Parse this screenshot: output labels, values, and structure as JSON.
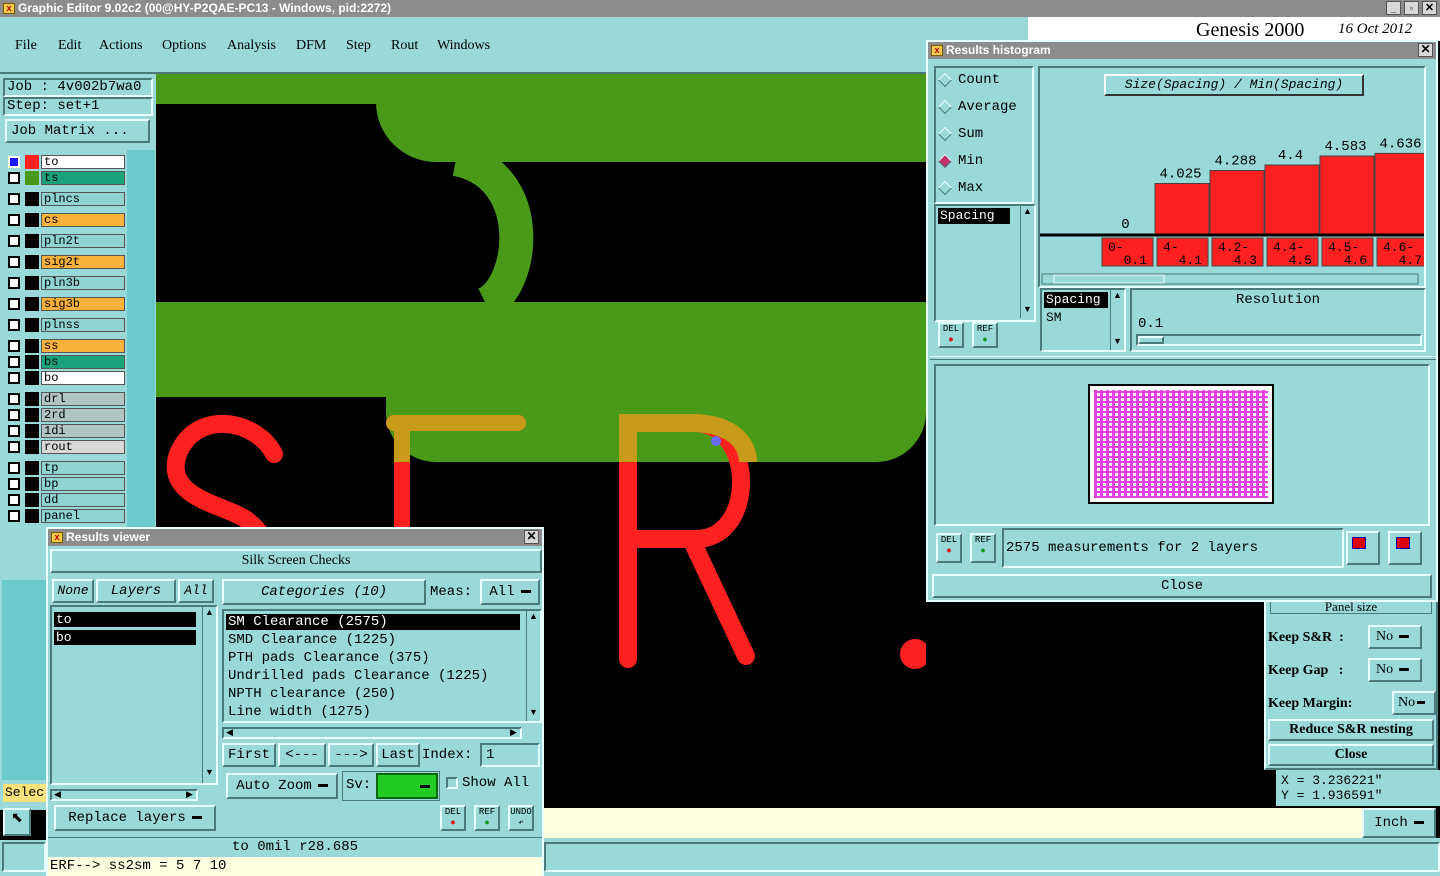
{
  "window": {
    "title": "Graphic Editor 9.02c2 (00@HY-P2QAE-PC13 - Windows, pid:2272)"
  },
  "menu": [
    "File",
    "Edit",
    "Actions",
    "Options",
    "Analysis",
    "DFM",
    "Step",
    "Rout",
    "Windows"
  ],
  "brand": {
    "text": "Genesis 2000",
    "date": "16 Oct 2012"
  },
  "job": {
    "job_label": "Job : 4v002b7wa0",
    "step_label": "Step: set+1",
    "matrix_button": "Job Matrix ..."
  },
  "layers": [
    {
      "name": "to",
      "color": "#ffffff",
      "swatch": "#ff2020"
    },
    {
      "name": "ts",
      "color": "#1aa37a",
      "swatch": "#4a9a1a"
    },
    {
      "name": "plncs",
      "color": "#8fd3d3",
      "swatch": "#000000"
    },
    {
      "name": "cs",
      "color": "#f8b23c",
      "swatch": "#000000"
    },
    {
      "name": "pln2t",
      "color": "#8fd3d3",
      "swatch": "#000000"
    },
    {
      "name": "sig2t",
      "color": "#f8b23c",
      "swatch": "#000000"
    },
    {
      "name": "pln3b",
      "color": "#8fd3d3",
      "swatch": "#000000"
    },
    {
      "name": "sig3b",
      "color": "#f8b23c",
      "swatch": "#000000"
    },
    {
      "name": "plnss",
      "color": "#8fd3d3",
      "swatch": "#000000"
    },
    {
      "name": "ss",
      "color": "#f8b23c",
      "swatch": "#000000"
    },
    {
      "name": "bs",
      "color": "#1aa37a",
      "swatch": "#000000"
    },
    {
      "name": "bo",
      "color": "#ffffff",
      "swatch": "#000000"
    },
    {
      "name": "drl",
      "color": "#b0c4c4",
      "swatch": "#000000"
    },
    {
      "name": "2rd",
      "color": "#b0c4c4",
      "swatch": "#000000"
    },
    {
      "name": "1di",
      "color": "#b0c4c4",
      "swatch": "#000000"
    },
    {
      "name": "rout",
      "color": "#d8d8d8",
      "swatch": "#000000"
    },
    {
      "name": "tp",
      "color": "#8fd3d3",
      "swatch": "#000000"
    },
    {
      "name": "bp",
      "color": "#8fd3d3",
      "swatch": "#000000"
    },
    {
      "name": "dd",
      "color": "#8fd3d3",
      "swatch": "#000000"
    },
    {
      "name": "panel",
      "color": "#8fd3d3",
      "swatch": "#000000"
    }
  ],
  "select_label": "Selec",
  "unit_button": "Inch",
  "coords": {
    "x": "X = 3.236221\"",
    "y": "Y = 1.936591\""
  },
  "results_viewer": {
    "title": "Results viewer",
    "header": "Silk Screen Checks",
    "none_btn": "None",
    "layers_btn": "Layers",
    "all_btn": "All",
    "layers": [
      "to",
      "bo"
    ],
    "categories_btn": "Categories (10)",
    "meas_label": "Meas:",
    "meas_value": "All",
    "categories": [
      "SM Clearance (2575)",
      "SMD Clearance (1225)",
      "PTH pads Clearance (375)",
      "Undrilled pads Clearance (1225)",
      "NPTH clearance (250)",
      "Line width (1275)"
    ],
    "first": "First",
    "prev": "<---",
    "next": "--->",
    "last": "Last",
    "index_label": "Index:",
    "index_value": "1",
    "auto_zoom": "Auto Zoom",
    "sv_label": "Sv:",
    "show_all": "Show All",
    "replace_layers": "Replace layers",
    "del": "DEL",
    "ref": "REF",
    "undo": "UNDO",
    "status": "to 0mil  r28.685",
    "erf": "ERF--> ss2sm = 5 7 10"
  },
  "histogram": {
    "title": "Results histogram",
    "modes": [
      "Count",
      "Average",
      "Sum",
      "Min",
      "Max"
    ],
    "selected_mode": "Min",
    "chart_title": "Size(Spacing) / Min(Spacing)",
    "metric_list": [
      "Spacing"
    ],
    "spacing_list_header": "Spacing",
    "spacing_list": [
      "SM"
    ],
    "resolution_label": "Resolution",
    "resolution_value": "0.1",
    "summary": "2575 measurements for 2 layers",
    "close": "Close",
    "del": "DEL",
    "ref": "REF"
  },
  "chart_data": {
    "type": "bar",
    "title": "Size(Spacing) / Min(Spacing)",
    "categories": [
      "0-0.1",
      "4-4.1",
      "4.2-4.3",
      "4.4-4.5",
      "4.5-4.6",
      "4.6-4.7"
    ],
    "values": [
      0,
      4.025,
      4.288,
      4.4,
      4.583,
      4.636
    ],
    "value_labels": [
      "0",
      "4.025",
      "4.288",
      "4.4",
      "4.583",
      "4.636"
    ],
    "category_labels": [
      [
        "0-",
        "0.1"
      ],
      [
        "4-",
        "4.1"
      ],
      [
        "4.2-",
        "4.3"
      ],
      [
        "4.4-",
        "4.5"
      ],
      [
        "4.5-",
        "4.6"
      ],
      [
        "4.6-",
        "4.7"
      ]
    ],
    "ylim": [
      0,
      5.5
    ],
    "bar_color": "#ff2020"
  },
  "side_panel": {
    "panel_size": "Panel size",
    "keep_sr_label": "Keep S&R  :",
    "keep_sr_value": "No",
    "keep_gap_label": "Keep Gap   :",
    "keep_gap_value": "No",
    "keep_margin_label": "Keep Margin:",
    "keep_margin_value": "No",
    "reduce": "Reduce S&R nesting",
    "close": "Close"
  },
  "canvas_text": {
    "letters": [
      "S",
      "T",
      "R",
      "."
    ]
  }
}
